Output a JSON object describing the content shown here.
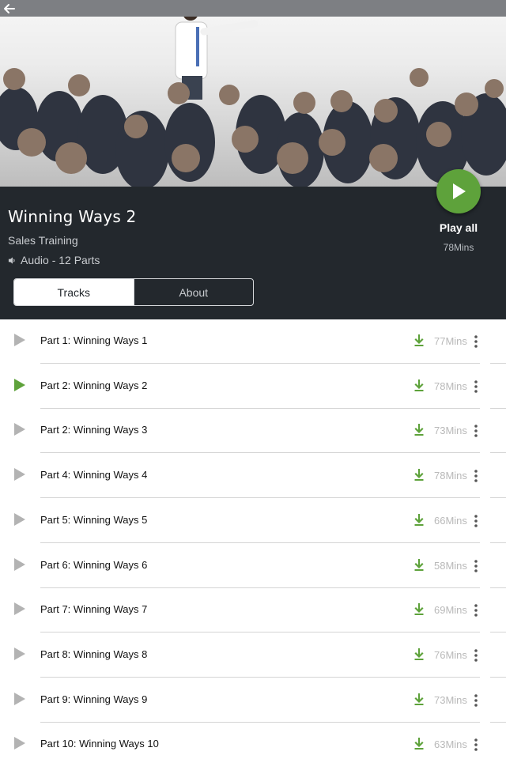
{
  "header": {
    "back_icon": "arrow-left-icon"
  },
  "course": {
    "title": "Winning Ways 2",
    "subtitle": "Sales Training",
    "media_type": "Audio - 12 Parts",
    "media_icon": "speaker-icon"
  },
  "play_all": {
    "label": "Play all",
    "duration": "78Mins",
    "color": "#5ea23b"
  },
  "tabs": [
    {
      "label": "Tracks",
      "active": true
    },
    {
      "label": "About",
      "active": false
    }
  ],
  "tracks": [
    {
      "title": "Part 1: Winning Ways 1",
      "duration": "77Mins",
      "playing": false
    },
    {
      "title": "Part 2: Winning Ways 2",
      "duration": "78Mins",
      "playing": true
    },
    {
      "title": "Part 2: Winning Ways 3",
      "duration": "73Mins",
      "playing": false
    },
    {
      "title": "Part 4: Winning Ways 4",
      "duration": "78Mins",
      "playing": false
    },
    {
      "title": "Part 5: Winning Ways 5",
      "duration": "66Mins",
      "playing": false
    },
    {
      "title": "Part 6: Winning Ways 6",
      "duration": "58Mins",
      "playing": false
    },
    {
      "title": "Part 7: Winning Ways 7",
      "duration": "69Mins",
      "playing": false
    },
    {
      "title": "Part 8: Winning Ways 8",
      "duration": "76Mins",
      "playing": false
    },
    {
      "title": "Part 9: Winning Ways 9",
      "duration": "73Mins",
      "playing": false
    },
    {
      "title": "Part 10: Winning Ways 10",
      "duration": "63Mins",
      "playing": false
    }
  ],
  "colors": {
    "panel_bg": "#23282d",
    "accent_green": "#5ea23b",
    "inactive_play": "#b3b3b3",
    "duration_text": "#b9b9b9"
  }
}
